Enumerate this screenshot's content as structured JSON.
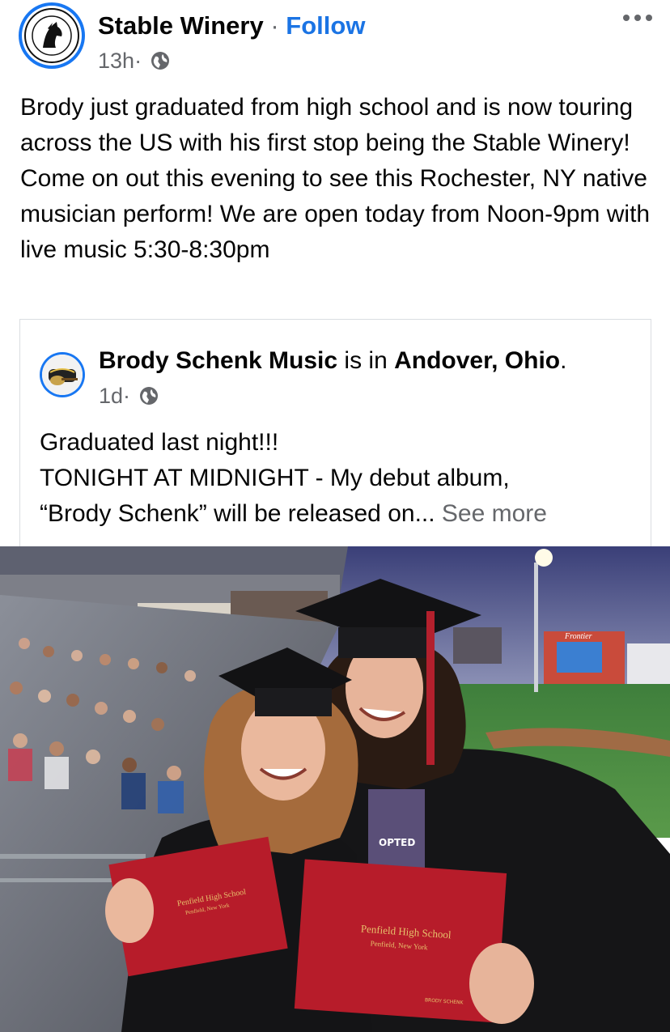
{
  "post": {
    "page_name": "Stable Winery",
    "separator": " · ",
    "follow_label": "Follow",
    "time": "13h",
    "meta_dot": " · ",
    "audience_icon": "globe-icon",
    "more_icon": "more-options-icon",
    "text": "Brody just graduated from high school and is now touring across the US with his first stop being the Stable Winery! Come on out this evening to see this Rochester, NY native musician perform! We are open today from Noon-9pm with live music 5:30-8:30pm"
  },
  "shared": {
    "author": "Brody Schenk Music",
    "is_in": " is in ",
    "location": "Andover, Ohio",
    "period": ".",
    "time": "1d",
    "meta_dot": " · ",
    "audience_icon": "globe-icon",
    "line1": "Graduated last night!!!",
    "line2": "TONIGHT AT MIDNIGHT - My debut album,",
    "line3": "“Brody Schenk” will be released on...",
    "see_more": "See more"
  },
  "photo": {
    "diploma_left_line1": "Penfield High School",
    "diploma_left_line2": "Penfield, New York",
    "diploma_right_line1": "Penfield High School",
    "diploma_right_line2": "Penfield, New York",
    "diploma_right_name": "BRODY SCHENK",
    "scoreboard_text": "Frontier",
    "shirt_text": "OPTED"
  },
  "colors": {
    "link_blue": "#1b74e4",
    "secondary_text": "#65676b",
    "primary_text": "#050505",
    "avatar_ring": "#1877f2",
    "diploma_red": "#b71c2a"
  }
}
